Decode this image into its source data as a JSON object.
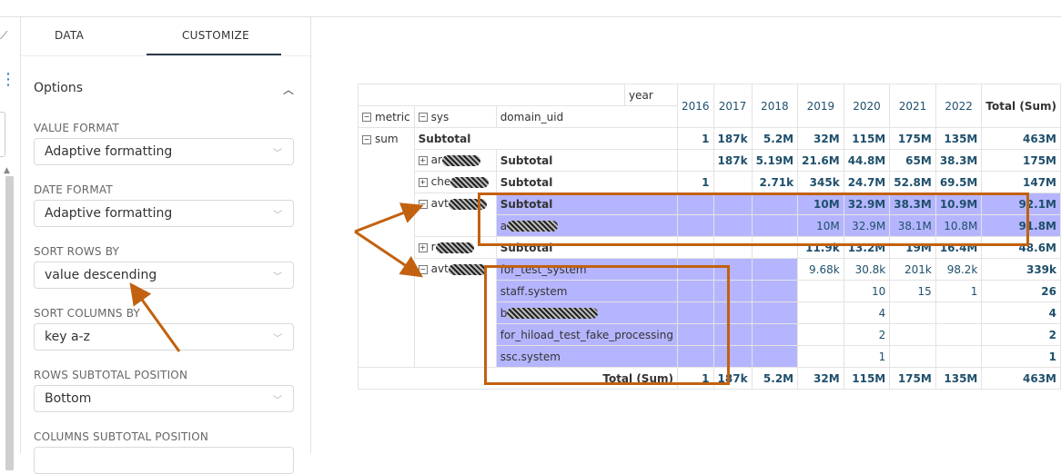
{
  "tabs": {
    "data": "DATA",
    "customize": "CUSTOMIZE"
  },
  "options": {
    "title": "Options",
    "fields": [
      {
        "label": "VALUE FORMAT",
        "value": "Adaptive formatting"
      },
      {
        "label": "DATE FORMAT",
        "value": "Adaptive formatting"
      },
      {
        "label": "SORT ROWS BY",
        "value": "value descending"
      },
      {
        "label": "SORT COLUMNS BY",
        "value": "key a-z"
      },
      {
        "label": "ROWS SUBTOTAL POSITION",
        "value": "Bottom"
      },
      {
        "label": "COLUMNS SUBTOTAL POSITION",
        "value": ""
      }
    ]
  },
  "pivot": {
    "col_dim": "year",
    "row_dims": [
      "metric",
      "sys",
      "domain_uid"
    ],
    "years": [
      "2016",
      "2017",
      "2018",
      "2019",
      "2020",
      "2021",
      "2022"
    ],
    "total_header": "Total (Sum)",
    "rows": [
      {
        "metric": "sum",
        "sys": "Subtotal",
        "domain": "",
        "values": [
          "1",
          "187k",
          "5.2M",
          "32M",
          "115M",
          "175M",
          "135M"
        ],
        "total": "463M"
      },
      {
        "metric": "",
        "sys": "ar",
        "domain": "Subtotal",
        "values": [
          "",
          "187k",
          "5.19M",
          "21.6M",
          "44.8M",
          "65M",
          "38.3M"
        ],
        "total": "175M"
      },
      {
        "metric": "",
        "sys": "che",
        "domain": "Subtotal",
        "values": [
          "1",
          "",
          "2.71k",
          "345k",
          "24.7M",
          "52.8M",
          "69.5M"
        ],
        "total": "147M"
      },
      {
        "metric": "",
        "sys": "avt",
        "domain": "Subtotal",
        "values": [
          "",
          "",
          "",
          "10M",
          "32.9M",
          "38.3M",
          "10.9M"
        ],
        "total": "92.1M"
      },
      {
        "metric": "",
        "sys": "",
        "domain": "a",
        "values": [
          "",
          "",
          "",
          "10M",
          "32.9M",
          "38.1M",
          "10.8M"
        ],
        "total": "91.8M"
      },
      {
        "metric": "",
        "sys": "r",
        "domain": "Subtotal",
        "values": [
          "",
          "",
          "",
          "11.9k",
          "13.2M",
          "19M",
          "16.4M"
        ],
        "total": "48.6M"
      },
      {
        "metric": "",
        "sys": "avt",
        "domain": "for_test_system",
        "values": [
          "",
          "",
          "",
          "9.68k",
          "30.8k",
          "201k",
          "98.2k"
        ],
        "total": "339k"
      },
      {
        "metric": "",
        "sys": "",
        "domain": "staff.system",
        "values": [
          "",
          "",
          "",
          "",
          "10",
          "15",
          "1"
        ],
        "total": "26"
      },
      {
        "metric": "",
        "sys": "",
        "domain": "b",
        "values": [
          "",
          "",
          "",
          "",
          "4",
          "",
          ""
        ],
        "total": "4"
      },
      {
        "metric": "",
        "sys": "",
        "domain": "for_hiload_test_fake_processing",
        "values": [
          "",
          "",
          "",
          "",
          "2",
          "",
          ""
        ],
        "total": "2"
      },
      {
        "metric": "",
        "sys": "",
        "domain": "ssc.system",
        "values": [
          "",
          "",
          "",
          "",
          "1",
          "",
          ""
        ],
        "total": "1"
      }
    ],
    "total_row": {
      "label": "Total (Sum)",
      "values": [
        "1",
        "187k",
        "5.2M",
        "32M",
        "115M",
        "175M",
        "135M"
      ],
      "total": "463M"
    }
  },
  "colors": {
    "highlight": "#7878ff",
    "annotation": "#c2610f",
    "value_text": "#1f4f6b"
  }
}
